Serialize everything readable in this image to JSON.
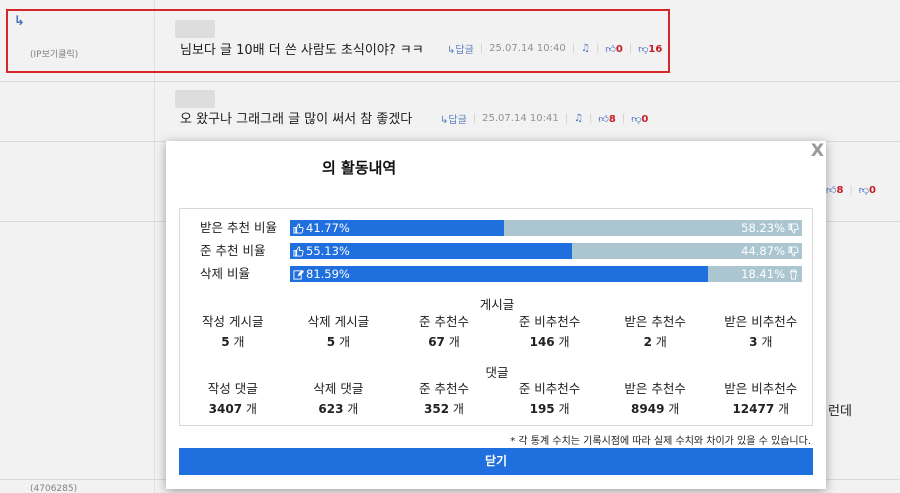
{
  "comments": [
    {
      "ip": "(IP보기클릭)",
      "text": "님보다 글 10배 더 쓴 사람도 초식이야? ㅋㅋ",
      "reply_label": "↳답글",
      "date": "25.07.14 10:40",
      "up": "0",
      "down": "16"
    },
    {
      "text": "오 왔구나 그래그래 글 많이 써서 참 좋겠다",
      "reply_label": "↳답글",
      "date": "25.07.14 10:41",
      "up": "8",
      "down": "0"
    },
    {
      "up": "8",
      "down": "0"
    },
    {
      "tail": "런데"
    },
    {
      "ip": "(4706285)"
    }
  ],
  "modal": {
    "title": "의 활동내역",
    "close_x": "X",
    "ratios": [
      {
        "label": "받은 추천 비율",
        "left": "41.77%",
        "right": "58.23%",
        "value": 41.77,
        "left_icon": "thumbs-up-icon",
        "right_icon": "thumbs-down-icon"
      },
      {
        "label": "준 추천 비율",
        "left": "55.13%",
        "right": "44.87%",
        "value": 55.13,
        "left_icon": "thumbs-up-icon",
        "right_icon": "thumbs-down-icon"
      },
      {
        "label": "삭제 비율",
        "left": "81.59%",
        "right": "18.41%",
        "value": 81.59,
        "left_icon": "edit-icon",
        "right_icon": "trash-icon"
      }
    ],
    "posts_title": "게시글",
    "posts": [
      {
        "label": "작성 게시글",
        "value": "5",
        "unit": " 개"
      },
      {
        "label": "삭제 게시글",
        "value": "5",
        "unit": " 개"
      },
      {
        "label": "준 추천수",
        "value": "67",
        "unit": " 개"
      },
      {
        "label": "준 비추천수",
        "value": "146",
        "unit": " 개"
      },
      {
        "label": "받은 추천수",
        "value": "2",
        "unit": " 개"
      },
      {
        "label": "받은 비추천수",
        "value": "3",
        "unit": " 개"
      }
    ],
    "comments_title": "댓글",
    "comment_stats": [
      {
        "label": "작성 댓글",
        "value": "3407",
        "unit": " 개"
      },
      {
        "label": "삭제 댓글",
        "value": "623",
        "unit": " 개"
      },
      {
        "label": "준 추천수",
        "value": "352",
        "unit": " 개"
      },
      {
        "label": "준 비추천수",
        "value": "195",
        "unit": " 개"
      },
      {
        "label": "받은 추천수",
        "value": "8949",
        "unit": " 개"
      },
      {
        "label": "받은 비추천수",
        "value": "12477",
        "unit": " 개"
      }
    ],
    "note": "* 각 통계 수치는 기록시점에 따라 실제 수치와 차이가 있을 수 있습니다.",
    "close_button": "닫기"
  },
  "colors": {
    "accent": "#1f6fde",
    "bar_bg": "#abc6d1",
    "highlight": "#e12a2a",
    "count": "#d0202a"
  }
}
